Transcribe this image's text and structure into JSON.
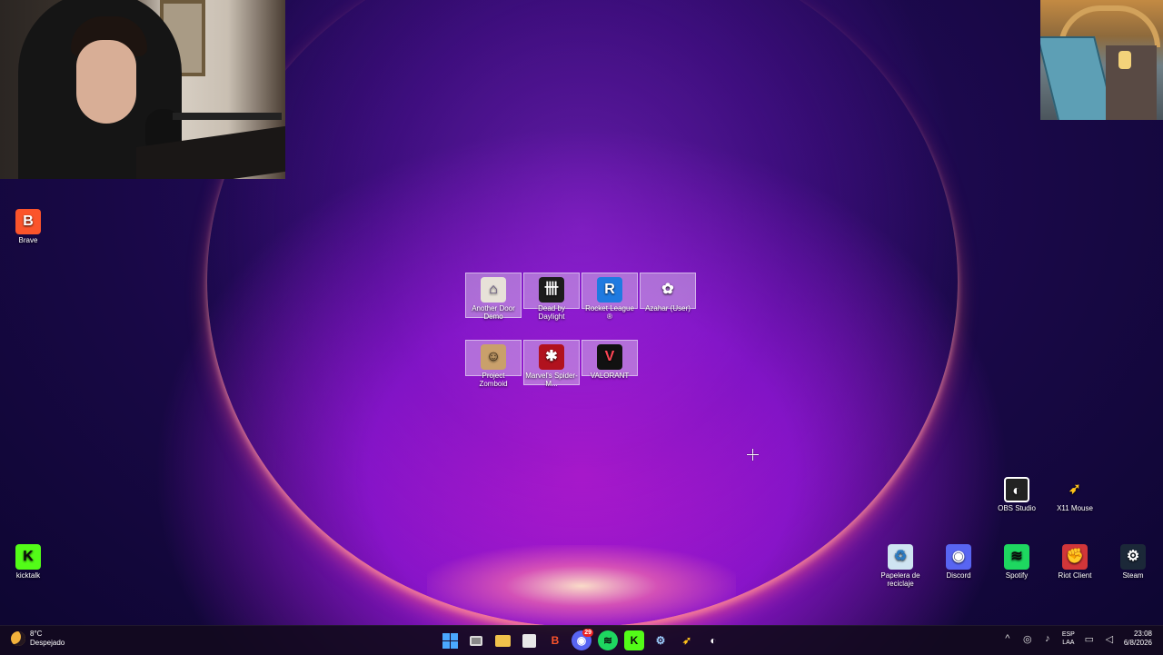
{
  "desktop": {
    "left_icons": [
      {
        "name": "Brave",
        "glyph": "B",
        "icon": "brave-icon"
      },
      {
        "name": "kicktalk",
        "glyph": "K",
        "icon": "kick-icon"
      }
    ],
    "group_icons_row1": [
      {
        "name": "Another Door Demo",
        "glyph": "⌂",
        "icon": "another-door-icon"
      },
      {
        "name": "Dead by Daylight",
        "glyph": "卌",
        "icon": "dead-by-daylight-icon"
      },
      {
        "name": "Rocket League ®",
        "glyph": "R",
        "icon": "rocket-league-icon"
      },
      {
        "name": "Azahar (User)",
        "glyph": "✿",
        "icon": "azahar-icon"
      }
    ],
    "group_icons_row2": [
      {
        "name": "Project Zomboid",
        "glyph": "☺",
        "icon": "project-zomboid-icon"
      },
      {
        "name": "Marvel's Spider-M...",
        "glyph": "✱",
        "icon": "spiderman-icon"
      },
      {
        "name": "VALORANT",
        "glyph": "V",
        "icon": "valorant-icon"
      }
    ],
    "right_icons_row1": [
      {
        "name": "OBS Studio",
        "glyph": "◐",
        "icon": "obs-icon"
      },
      {
        "name": "X11 Mouse",
        "glyph": "➶",
        "icon": "x11-mouse-icon"
      }
    ],
    "right_icons_row2": [
      {
        "name": "Papelera de reciclaje",
        "glyph": "♻",
        "icon": "recycle-bin-icon"
      },
      {
        "name": "Discord",
        "glyph": "◉",
        "icon": "discord-icon"
      },
      {
        "name": "Spotify",
        "glyph": "≋",
        "icon": "spotify-icon"
      },
      {
        "name": "Riot Client",
        "glyph": "✊",
        "icon": "riot-client-icon"
      },
      {
        "name": "Steam",
        "glyph": "⚙",
        "icon": "steam-icon"
      }
    ]
  },
  "taskbar": {
    "weather": {
      "temp": "8°C",
      "condition": "Despejado"
    },
    "apps": [
      "start",
      "task-view",
      "file-explorer",
      "store",
      "brave",
      "discord",
      "spotify",
      "kick",
      "steam",
      "x11-mouse",
      "obs"
    ],
    "discord_badge": "29",
    "tray": {
      "lang_top": "ESP",
      "lang_bottom": "LAA",
      "time": "23:08",
      "date": "6/8/2026"
    }
  },
  "colors": {
    "accent": "#4aa8ff",
    "taskbar_bg": "#120a1e",
    "selection": "#d4b4e8"
  }
}
